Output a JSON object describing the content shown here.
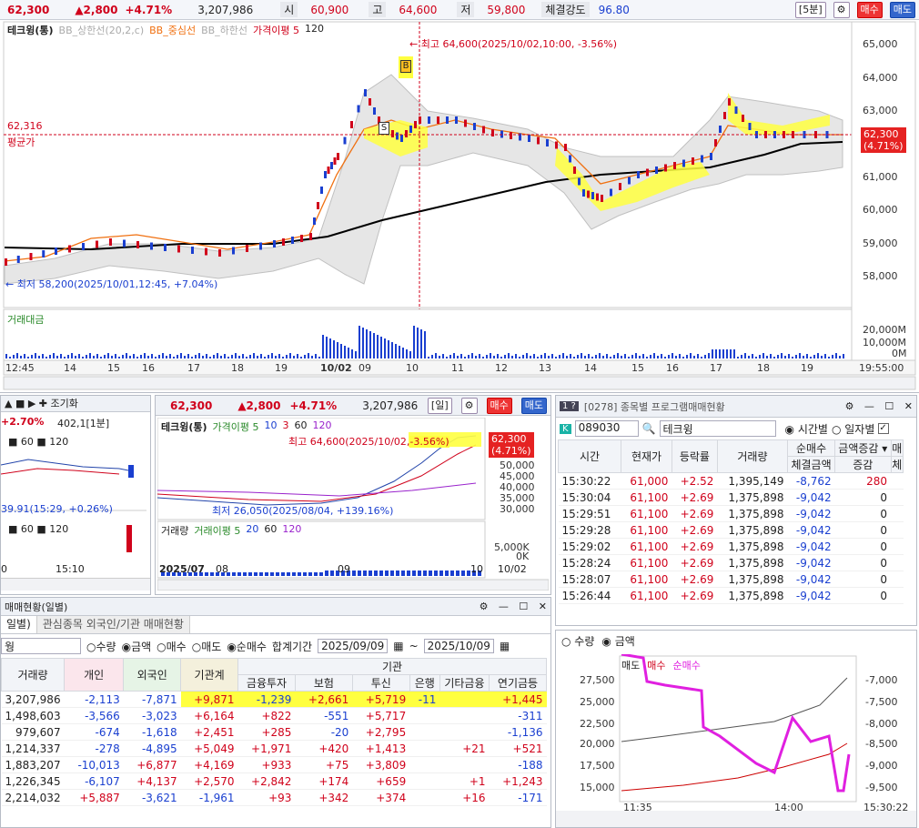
{
  "top": {
    "price": "62,300",
    "change": "▲2,800",
    "pct": "+4.71%",
    "volume": "3,207,986",
    "open_lbl": "시",
    "open": "60,900",
    "high_lbl": "고",
    "high": "64,600",
    "low_lbl": "저",
    "low": "59,800",
    "strength_lbl": "체결강도",
    "strength": "96.80",
    "period": "[5분]",
    "buy": "매수",
    "sell": "매도"
  },
  "main": {
    "legend": [
      "테크윙(통)",
      "BB_상한선(20,2,c)",
      "BB_중심선",
      "BB_하한선",
      "가격이평 5",
      "120"
    ],
    "high_note": "최고 64,600(2025/10/02,10:00, -3.56%)",
    "low_note": "최저 58,200(2025/10/01,12:45, +7.04%)",
    "avg_price": "62,316",
    "avg_label": "평균가",
    "cur_label": "62,300",
    "cur_pct": "(4.71%)",
    "yticks": [
      "65,000",
      "64,000",
      "63,000",
      "62,000",
      "61,000",
      "60,000",
      "59,000",
      "58,000"
    ],
    "vol_title": "거래대금",
    "vol_ticks": [
      "20,000M",
      "10,000M",
      "0M"
    ],
    "xticks": [
      "12:45",
      "14",
      "15",
      "16",
      "17",
      "18",
      "19",
      "10/02",
      "09",
      "10",
      "11",
      "12",
      "13",
      "14",
      "15",
      "16",
      "17",
      "18",
      "19",
      "19:55:00"
    ],
    "mark_b": "B",
    "mark_s": "S"
  },
  "left": {
    "pct": "+2.70%",
    "val": "402,1[1분]",
    "legend": [
      "60",
      "120"
    ],
    "note": "39.91(15:29, +0.26%)",
    "xticks": [
      "0",
      "15:10"
    ]
  },
  "mid": {
    "price": "62,300",
    "change": "▲2,800",
    "pct": "+4.71%",
    "volume": "3,207,986",
    "period": "[일]",
    "buy": "매수",
    "sell": "매도",
    "legend": [
      "테크윙(통)",
      "가격이평 5",
      "10",
      "3",
      "60",
      "120"
    ],
    "high_note": "최고 64,600(2025/10/02,",
    "high_pct": "-3.56%)",
    "low_note": "최저 26,050(2025/08/04, +139.16%)",
    "cur_label": "62,300",
    "cur_pct": "(4.71%)",
    "yticks": [
      "50,000",
      "45,000",
      "40,000",
      "35,000",
      "30,000"
    ],
    "vol_legend": [
      "거래량",
      "거래이평 5",
      "20",
      "60",
      "120"
    ],
    "vol_ticks": [
      "5,000K",
      "0K"
    ],
    "xticks": [
      "2025/07",
      "08",
      "09",
      "10",
      "10/02"
    ]
  },
  "prog": {
    "title": "[0278] 종목별 프로그램매매현황",
    "code": "089030",
    "name": "테크윙",
    "opt1": "시간별",
    "opt2": "일자별",
    "headers": [
      "시간",
      "현재가",
      "등락률",
      "거래량",
      "순매수",
      "체결금액",
      "증감",
      "매",
      "체"
    ],
    "combo": "금액증감",
    "rows": [
      [
        "15:30:22",
        "61,000",
        "+2.52",
        "1,395,149",
        "-8,762",
        "280"
      ],
      [
        "15:30:04",
        "61,100",
        "+2.69",
        "1,375,898",
        "-9,042",
        "0"
      ],
      [
        "15:29:51",
        "61,100",
        "+2.69",
        "1,375,898",
        "-9,042",
        "0"
      ],
      [
        "15:29:28",
        "61,100",
        "+2.69",
        "1,375,898",
        "-9,042",
        "0"
      ],
      [
        "15:29:02",
        "61,100",
        "+2.69",
        "1,375,898",
        "-9,042",
        "0"
      ],
      [
        "15:28:24",
        "61,100",
        "+2.69",
        "1,375,898",
        "-9,042",
        "0"
      ],
      [
        "15:28:07",
        "61,100",
        "+2.69",
        "1,375,898",
        "-9,042",
        "0"
      ],
      [
        "15:26:44",
        "61,100",
        "+2.69",
        "1,375,898",
        "-9,042",
        "0"
      ]
    ]
  },
  "pchart": {
    "opt1": "수량",
    "opt2": "금액",
    "legend": [
      "매도",
      "매수",
      "순매수"
    ],
    "yleft": [
      "27,500",
      "25,000",
      "22,500",
      "20,000",
      "17,500",
      "15,000"
    ],
    "yright": [
      "-7,000",
      "-7,500",
      "-8,000",
      "-8,500",
      "-9,000",
      "-9,500"
    ],
    "xticks": [
      "11:35",
      "14:00",
      "15:30:22"
    ]
  },
  "inv": {
    "title": "매매현황(일별)",
    "tab1": "일별)",
    "tab2": "관심종목 외국인/기관 매매현황",
    "code": "웡",
    "radios": [
      "수량",
      "금액",
      "매수",
      "매도",
      "순매수"
    ],
    "period_lbl": "합계기간",
    "from": "2025/09/09",
    "to": "2025/10/09",
    "headers": [
      "거래량",
      "개인",
      "외국인",
      "기관계",
      "금융투자",
      "보험",
      "투신",
      "은행",
      "기타금융",
      "연기금등"
    ],
    "inst_hdr": "기관",
    "rows": [
      [
        "3,207,986",
        "-2,113",
        "-7,871",
        "+9,871",
        "-1,239",
        "+2,661",
        "+5,719",
        "-11",
        "",
        "+1,445"
      ],
      [
        "1,498,603",
        "-3,566",
        "-3,023",
        "+6,164",
        "+822",
        "-551",
        "+5,717",
        "",
        "",
        "-311"
      ],
      [
        "979,607",
        "-674",
        "-1,618",
        "+2,451",
        "+285",
        "-20",
        "+2,795",
        "",
        "",
        "-1,136"
      ],
      [
        "1,214,337",
        "-278",
        "-4,895",
        "+5,049",
        "+1,971",
        "+420",
        "+1,413",
        "",
        "+21",
        "+521"
      ],
      [
        "1,883,207",
        "-10,013",
        "+6,877",
        "+4,169",
        "+933",
        "+75",
        "+3,809",
        "",
        "",
        "-188"
      ],
      [
        "1,226,345",
        "-6,107",
        "+4,137",
        "+2,570",
        "+2,842",
        "+174",
        "+659",
        "",
        "+1",
        "+1,243"
      ],
      [
        "2,214,032",
        "+5,887",
        "-3,621",
        "-1,961",
        "+93",
        "+342",
        "+374",
        "",
        "+16",
        "-171"
      ]
    ]
  }
}
